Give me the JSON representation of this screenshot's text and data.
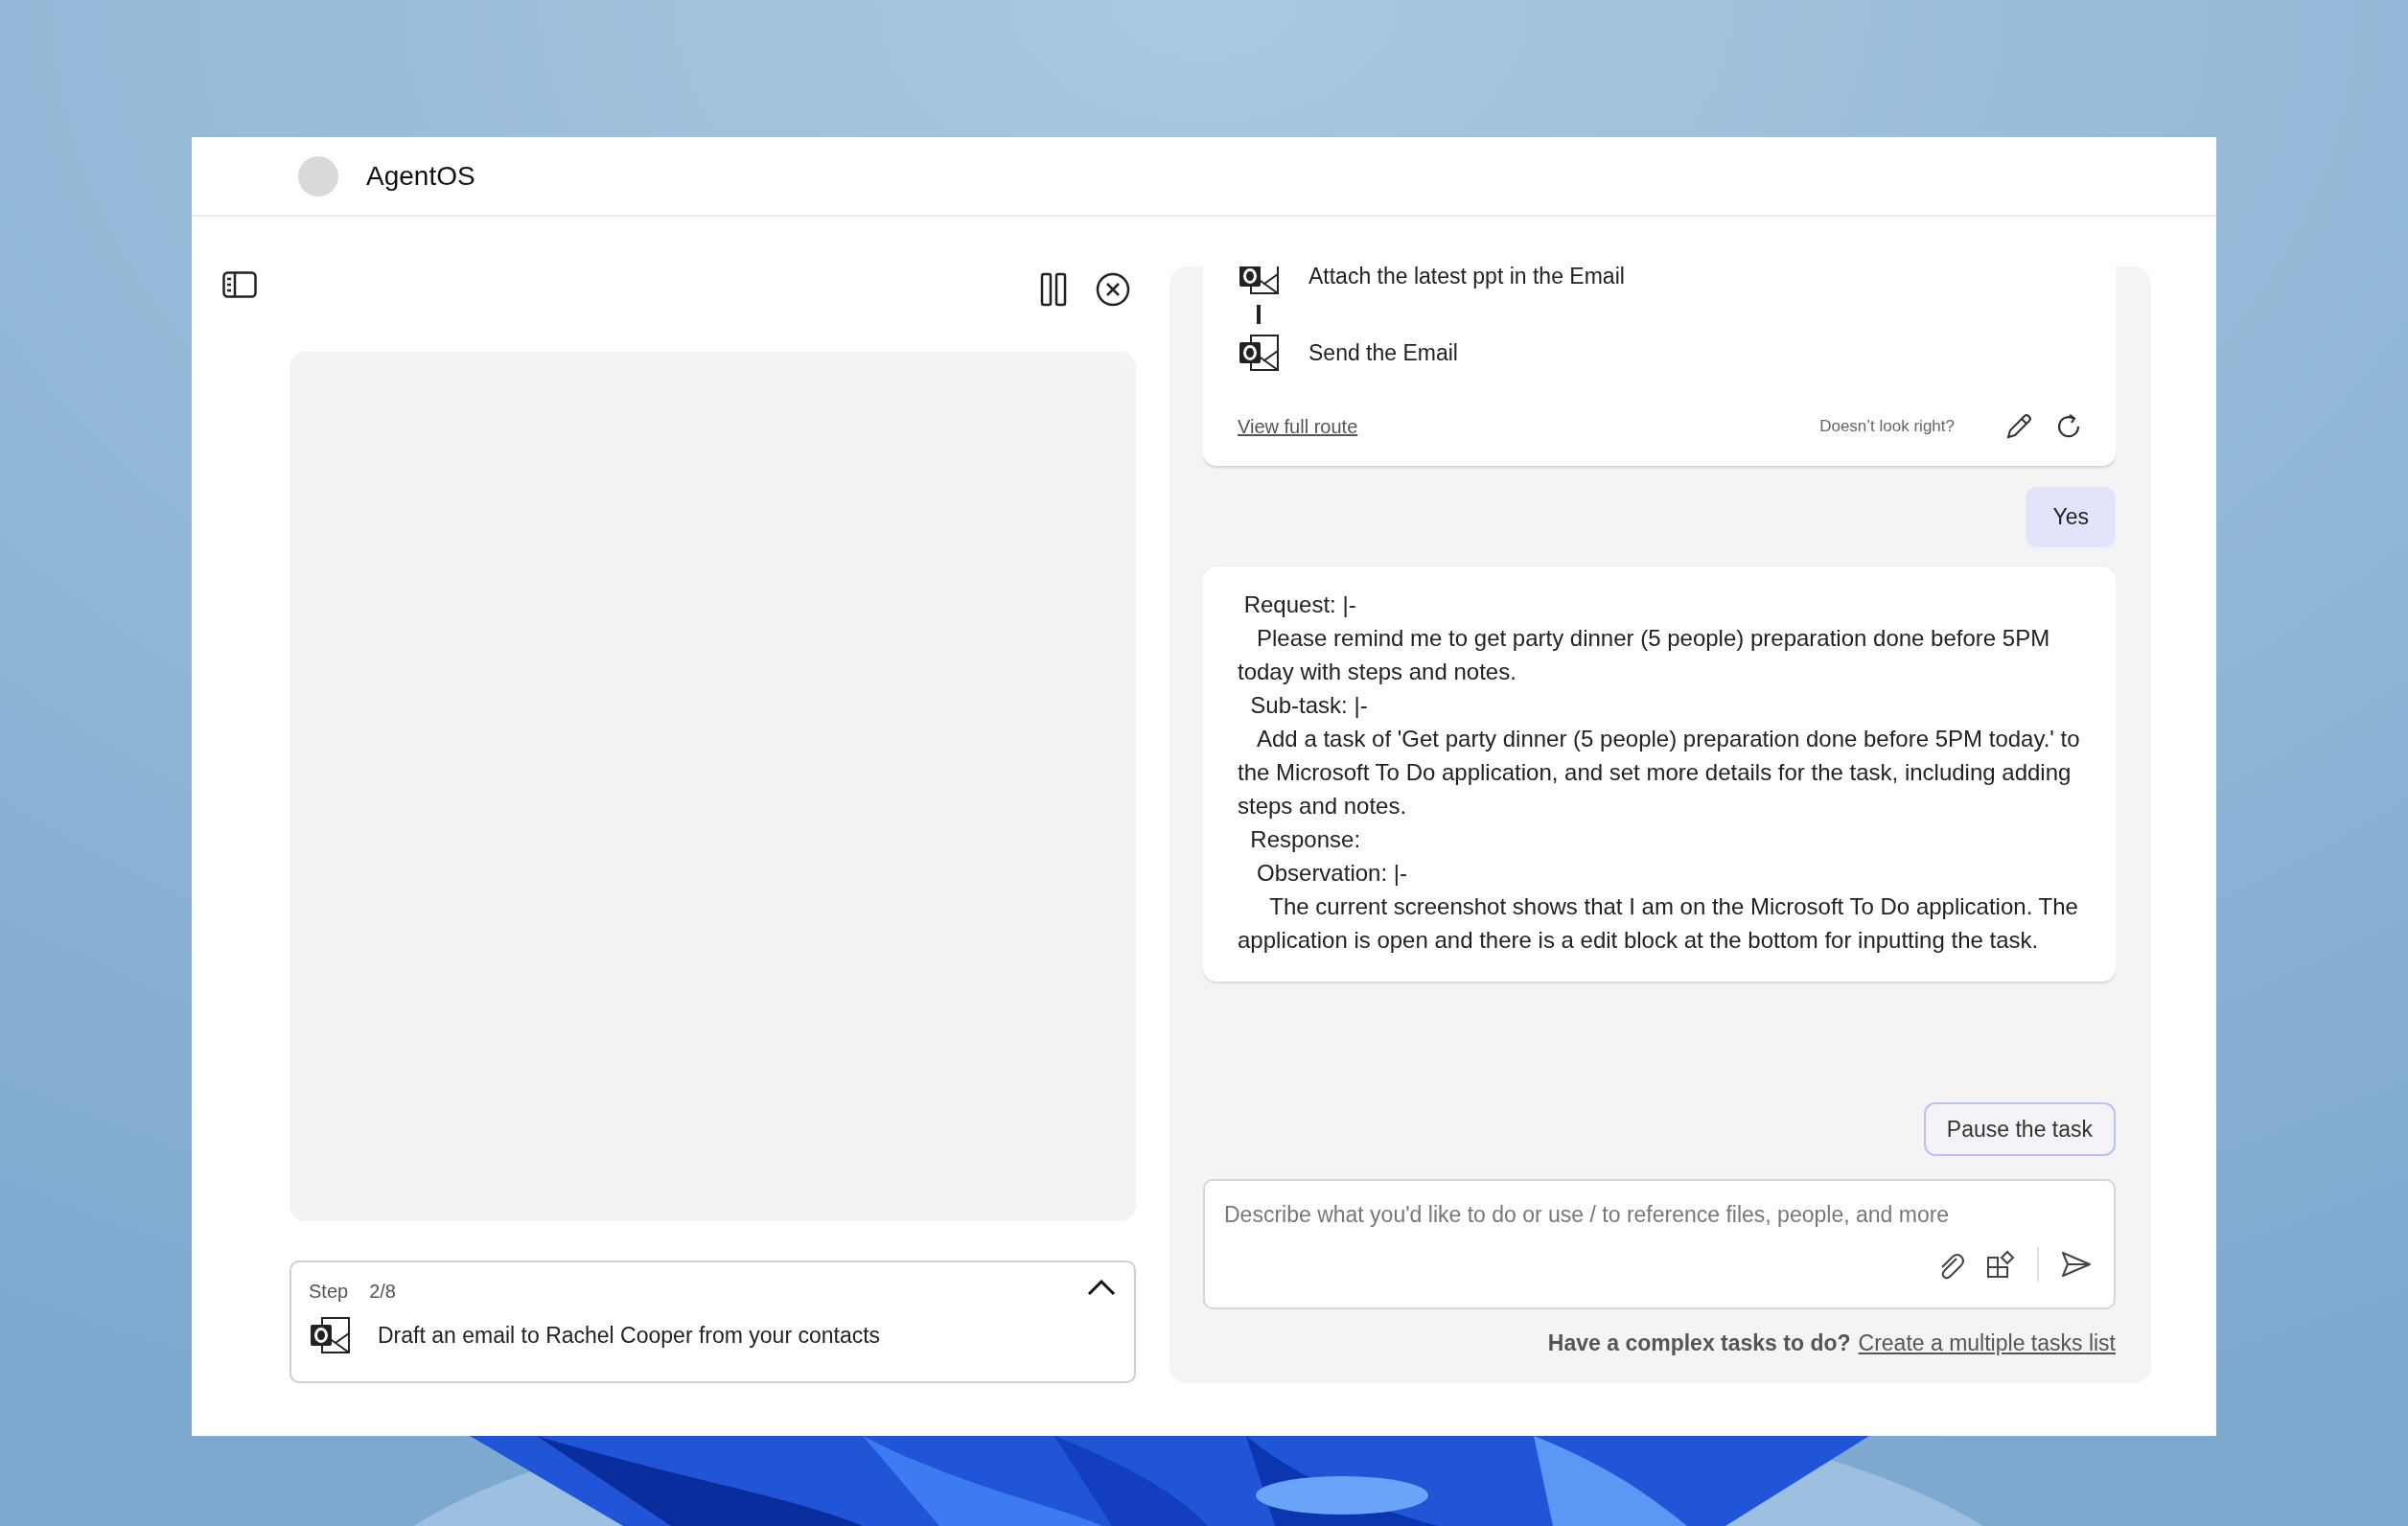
{
  "window": {
    "title": "AgentOS"
  },
  "viewer": {
    "step_label": "Step",
    "step_count": "2/8",
    "step_text": "Draft an email to Rachel Cooper from your contacts",
    "expanded": true
  },
  "route": {
    "steps": [
      {
        "text": "Attach the latest ppt in the Email"
      },
      {
        "text": "Send the Email"
      }
    ],
    "link": "View full route",
    "feedback": "Doesn’t look right?"
  },
  "messages": [
    {
      "kind": "user",
      "text": "Yes"
    },
    {
      "kind": "agent",
      "text": " Request: |-\n   Please remind me to get party dinner (5 people) preparation done before 5PM today with steps and notes.\n  Sub-task: |-\n   Add a task of 'Get party dinner (5 people) preparation done before 5PM today.' to the Microsoft To Do application, and set more details for the task, including adding steps and notes.\n  Response:\n   Observation: |-\n     The current screenshot shows that I am on the Microsoft To Do application. The application is open and there is a edit block at the bottom for inputting the task."
    }
  ],
  "pause_button": "Pause the task",
  "composer": {
    "placeholder": "Describe what you'd like to do or use / to reference files, people, and more"
  },
  "footer": {
    "prompt": "Have a complex tasks to do?",
    "link": "Create a multiple tasks list"
  }
}
